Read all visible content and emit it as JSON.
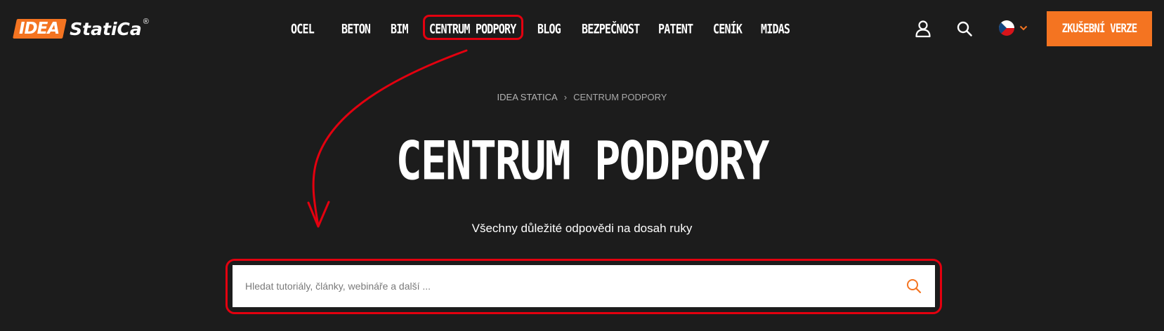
{
  "header": {
    "logo_box": "IDEA",
    "logo_text": "StatiCa",
    "logo_reg": "®",
    "nav": [
      {
        "label": "OCEL"
      },
      {
        "label": "BETON"
      },
      {
        "label": "BIM"
      },
      {
        "label": "CENTRUM PODPORY"
      },
      {
        "label": "BLOG"
      },
      {
        "label": "BEZPEČNOST"
      },
      {
        "label": "PATENT"
      },
      {
        "label": "CENÍK"
      },
      {
        "label": "MIDAS"
      }
    ],
    "icons": {
      "user": "user-icon",
      "search": "search-icon",
      "language": "czech-flag-icon",
      "dropdown": "chevron-down-icon"
    },
    "cta_label": "ZKUŠEBNÍ VERZE"
  },
  "breadcrumb": {
    "items": [
      "IDEA STATICA",
      "CENTRUM PODPORY"
    ],
    "separator": "›"
  },
  "main": {
    "title": "CENTRUM PODPORY",
    "subtitle": "Všechny důležité odpovědi na dosah ruky",
    "search": {
      "placeholder": "Hledat tutoriály, články, webináře a další ...",
      "value": ""
    }
  },
  "colors": {
    "background": "#1c1c1c",
    "accent": "#f47421",
    "annotation": "#e3000f",
    "text": "#ffffff"
  }
}
